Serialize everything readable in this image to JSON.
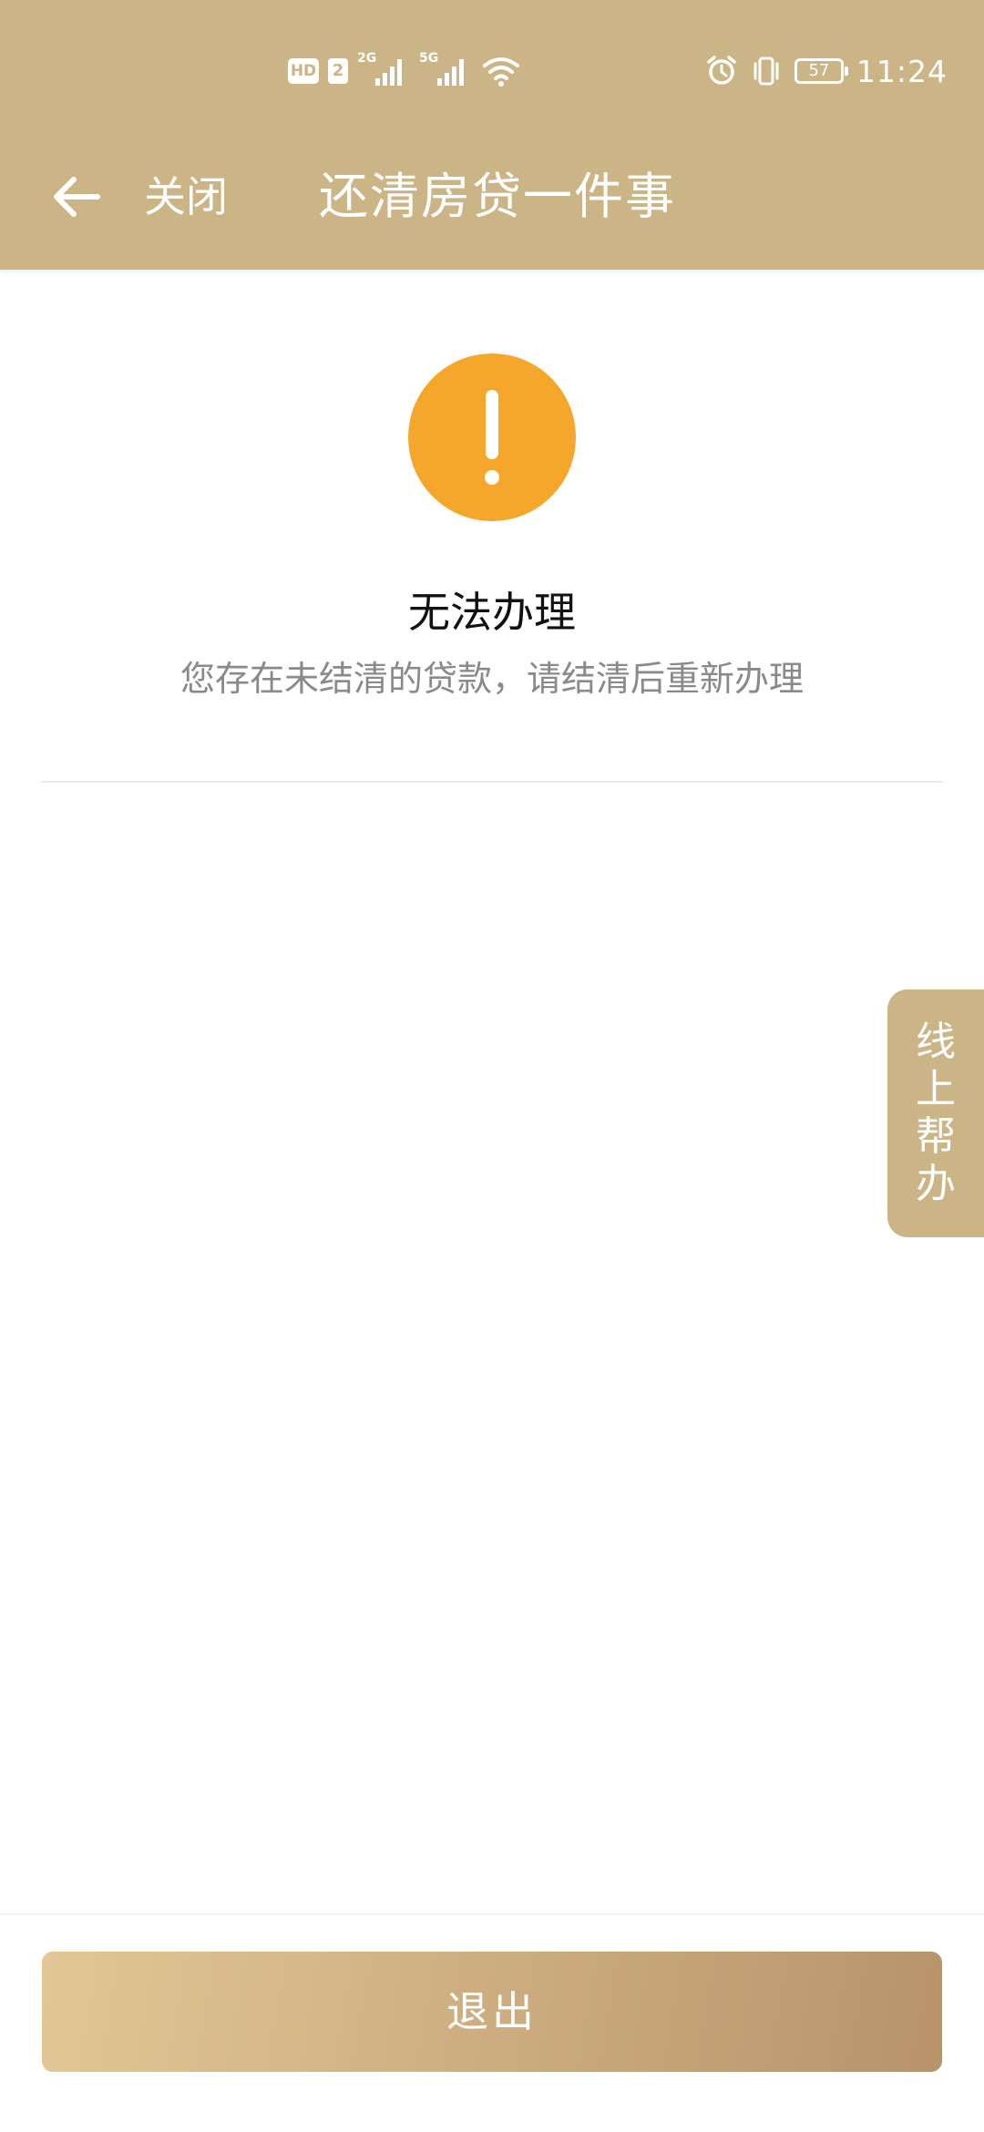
{
  "colors": {
    "brand": "#cbb586",
    "warning": "#f4a72b",
    "button_gradient_start": "#e2c796",
    "button_gradient_end": "#b8936a"
  },
  "status_bar": {
    "hd_label": "HD",
    "sim_label": "2",
    "network1": "2G",
    "network2": "5G",
    "battery": "57",
    "time": "11:24"
  },
  "nav": {
    "back_icon": "arrow-left-icon",
    "close_label": "关闭",
    "title": "还清房贷一件事"
  },
  "result": {
    "icon": "exclamation-icon",
    "title": "无法办理",
    "description": "您存在未结清的贷款，请结清后重新办理"
  },
  "side_tab": {
    "chars": [
      "线",
      "上",
      "帮",
      "办"
    ]
  },
  "footer": {
    "exit_label": "退出"
  }
}
